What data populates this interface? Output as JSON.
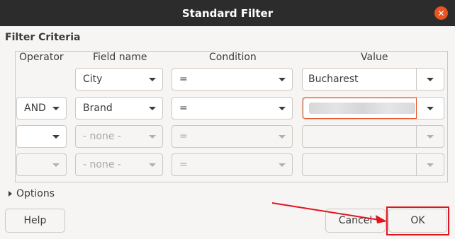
{
  "window": {
    "title": "Standard Filter"
  },
  "section": {
    "title": "Filter Criteria"
  },
  "columns": {
    "operator": "Operator",
    "field": "Field name",
    "condition": "Condition",
    "value": "Value"
  },
  "rows": [
    {
      "operator": "",
      "field": "City",
      "condition": "=",
      "value": "Bucharest"
    },
    {
      "operator": "AND",
      "field": "Brand",
      "condition": "=",
      "value": ""
    },
    {
      "operator": "",
      "field": "- none -",
      "condition": "=",
      "value": ""
    },
    {
      "operator": "",
      "field": "- none -",
      "condition": "=",
      "value": ""
    }
  ],
  "options": {
    "label": "Options"
  },
  "buttons": {
    "help": "Help",
    "cancel": "Cancel",
    "ok": "OK"
  },
  "colors": {
    "titlebar": "#2c2c2c",
    "accent": "#e95420",
    "annotation": "#e0141e"
  }
}
